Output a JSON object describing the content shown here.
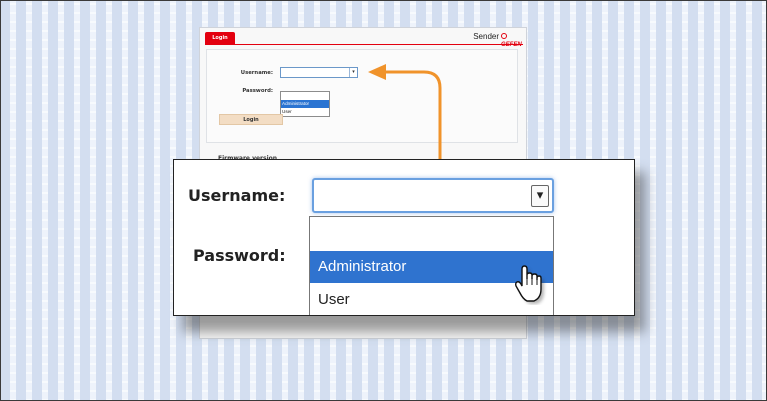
{
  "background_page": {
    "tab_label": "Login",
    "device_label": "Sender",
    "brand": "GEFEN",
    "username_label": "Username:",
    "password_label": "Password:",
    "username_options": [
      "",
      "Administrator",
      "User"
    ],
    "selected_option": "Administrator",
    "login_button": "Login",
    "firmware_heading": "Firmware version"
  },
  "callout": {
    "username_label": "Username:",
    "password_label": "Password:",
    "dropdown_arrow": "▾",
    "options": [
      {
        "label": "",
        "selected": false
      },
      {
        "label": "Administrator",
        "selected": true
      },
      {
        "label": "User",
        "selected": false
      }
    ]
  },
  "colors": {
    "brand_red": "#e3000f",
    "selection_blue": "#2f73cf",
    "arrow_orange": "#f0932b",
    "focus_blue": "#6aa0e0"
  },
  "icons": {
    "dropdown": "chevron-down-icon",
    "pointer": "mouse-pointer-icon",
    "arrow": "curved-arrow-icon"
  }
}
